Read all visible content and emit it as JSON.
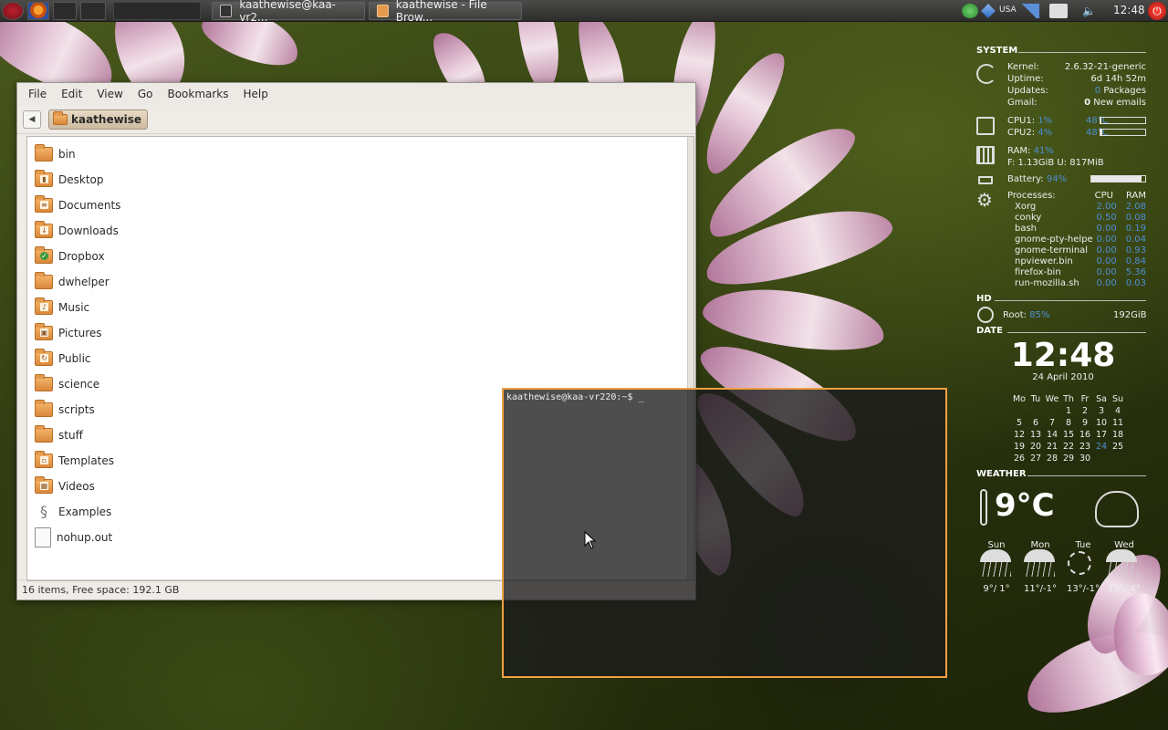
{
  "top_panel": {
    "tasks": [
      {
        "label": "kaathewise@kaa-vr2..."
      },
      {
        "label": "kaathewise - File Brow..."
      }
    ],
    "keyboard_layout": "USA",
    "clock": "12:48"
  },
  "file_browser": {
    "menu": [
      "File",
      "Edit",
      "View",
      "Go",
      "Bookmarks",
      "Help"
    ],
    "location": "kaathewise",
    "items": [
      {
        "name": "bin",
        "icon": "folder"
      },
      {
        "name": "Desktop",
        "icon": "folder-desktop"
      },
      {
        "name": "Documents",
        "icon": "folder-documents"
      },
      {
        "name": "Downloads",
        "icon": "folder-downloads"
      },
      {
        "name": "Dropbox",
        "icon": "folder-dropbox"
      },
      {
        "name": "dwhelper",
        "icon": "folder"
      },
      {
        "name": "Music",
        "icon": "folder-music"
      },
      {
        "name": "Pictures",
        "icon": "folder-pictures"
      },
      {
        "name": "Public",
        "icon": "folder-public"
      },
      {
        "name": "science",
        "icon": "folder"
      },
      {
        "name": "scripts",
        "icon": "folder"
      },
      {
        "name": "stuff",
        "icon": "folder"
      },
      {
        "name": "Templates",
        "icon": "folder-templates"
      },
      {
        "name": "Videos",
        "icon": "folder-videos"
      },
      {
        "name": "Examples",
        "icon": "examples-link"
      },
      {
        "name": "nohup.out",
        "icon": "text-file"
      }
    ],
    "status": "16 items, Free space: 192.1 GB"
  },
  "terminal": {
    "prompt": "kaathewise@kaa-vr220:~$ _"
  },
  "conky": {
    "system": {
      "heading": "SYSTEM",
      "kernel_label": "Kernel:",
      "kernel": "2.6.32-21-generic",
      "uptime_label": "Uptime:",
      "uptime": "6d 14h 52m",
      "updates_label": "Updates:",
      "updates_count": "0",
      "updates_unit": "Packages",
      "gmail_label": "Gmail:",
      "gmail_count": "0",
      "gmail_unit": "New emails",
      "cpu1_label": "CPU1:",
      "cpu1_pct": "1%",
      "cpu1_temp": "48°C",
      "cpu1_level": 0.01,
      "cpu2_label": "CPU2:",
      "cpu2_pct": "4%",
      "cpu2_temp": "48°C",
      "cpu2_level": 0.04,
      "ram_label": "RAM:",
      "ram_pct": "41%",
      "ram_detail": "F: 1.13GiB U: 817MiB",
      "battery_label": "Battery:",
      "battery_pct": "94%",
      "battery_level": 0.94,
      "processes_label": "Processes:",
      "cpu_col": "CPU",
      "ram_col": "RAM",
      "processes": [
        {
          "name": "Xorg",
          "cpu": "2.00",
          "ram": "2.08"
        },
        {
          "name": "conky",
          "cpu": "0.50",
          "ram": "0.08"
        },
        {
          "name": "bash",
          "cpu": "0.00",
          "ram": "0.19"
        },
        {
          "name": "gnome-pty-helpe",
          "cpu": "0.00",
          "ram": "0.04"
        },
        {
          "name": "gnome-terminal",
          "cpu": "0.00",
          "ram": "0.93"
        },
        {
          "name": "npviewer.bin",
          "cpu": "0.00",
          "ram": "0.84"
        },
        {
          "name": "firefox-bin",
          "cpu": "0.00",
          "ram": "5.36"
        },
        {
          "name": "run-mozilla.sh",
          "cpu": "0.00",
          "ram": "0.03"
        }
      ]
    },
    "hd": {
      "heading": "HD",
      "root_label": "Root:",
      "root_pct": "85%",
      "size": "192GiB"
    },
    "date": {
      "heading": "DATE",
      "time": "12:48",
      "date": "24 April 2010",
      "weekdays": [
        "Mo",
        "Tu",
        "We",
        "Th",
        "Fr",
        "Sa",
        "Su"
      ],
      "weeks": [
        [
          "",
          "",
          "",
          "1",
          "2",
          "3",
          "4"
        ],
        [
          "5",
          "6",
          "7",
          "8",
          "9",
          "10",
          "11"
        ],
        [
          "12",
          "13",
          "14",
          "15",
          "16",
          "17",
          "18"
        ],
        [
          "19",
          "20",
          "21",
          "22",
          "23",
          "24",
          "25"
        ],
        [
          "26",
          "27",
          "28",
          "29",
          "30",
          "",
          ""
        ]
      ],
      "today": "24"
    },
    "weather": {
      "heading": "WEATHER",
      "current": "9°C",
      "forecast": [
        {
          "day": "Sun",
          "temp": "9°/ 1°",
          "icon": "rain-icon"
        },
        {
          "day": "Mon",
          "temp": "11°/-1°",
          "icon": "sun-rain-icon"
        },
        {
          "day": "Tue",
          "temp": "13°/-1°",
          "icon": "sun-icon"
        },
        {
          "day": "Wed",
          "temp": "11°/ 4°",
          "icon": "sun-rain-icon"
        }
      ]
    }
  },
  "colors": {
    "accent_blue": "#4d8fd6",
    "terminal_border": "#f0a040",
    "folder": "#e39a4c"
  }
}
